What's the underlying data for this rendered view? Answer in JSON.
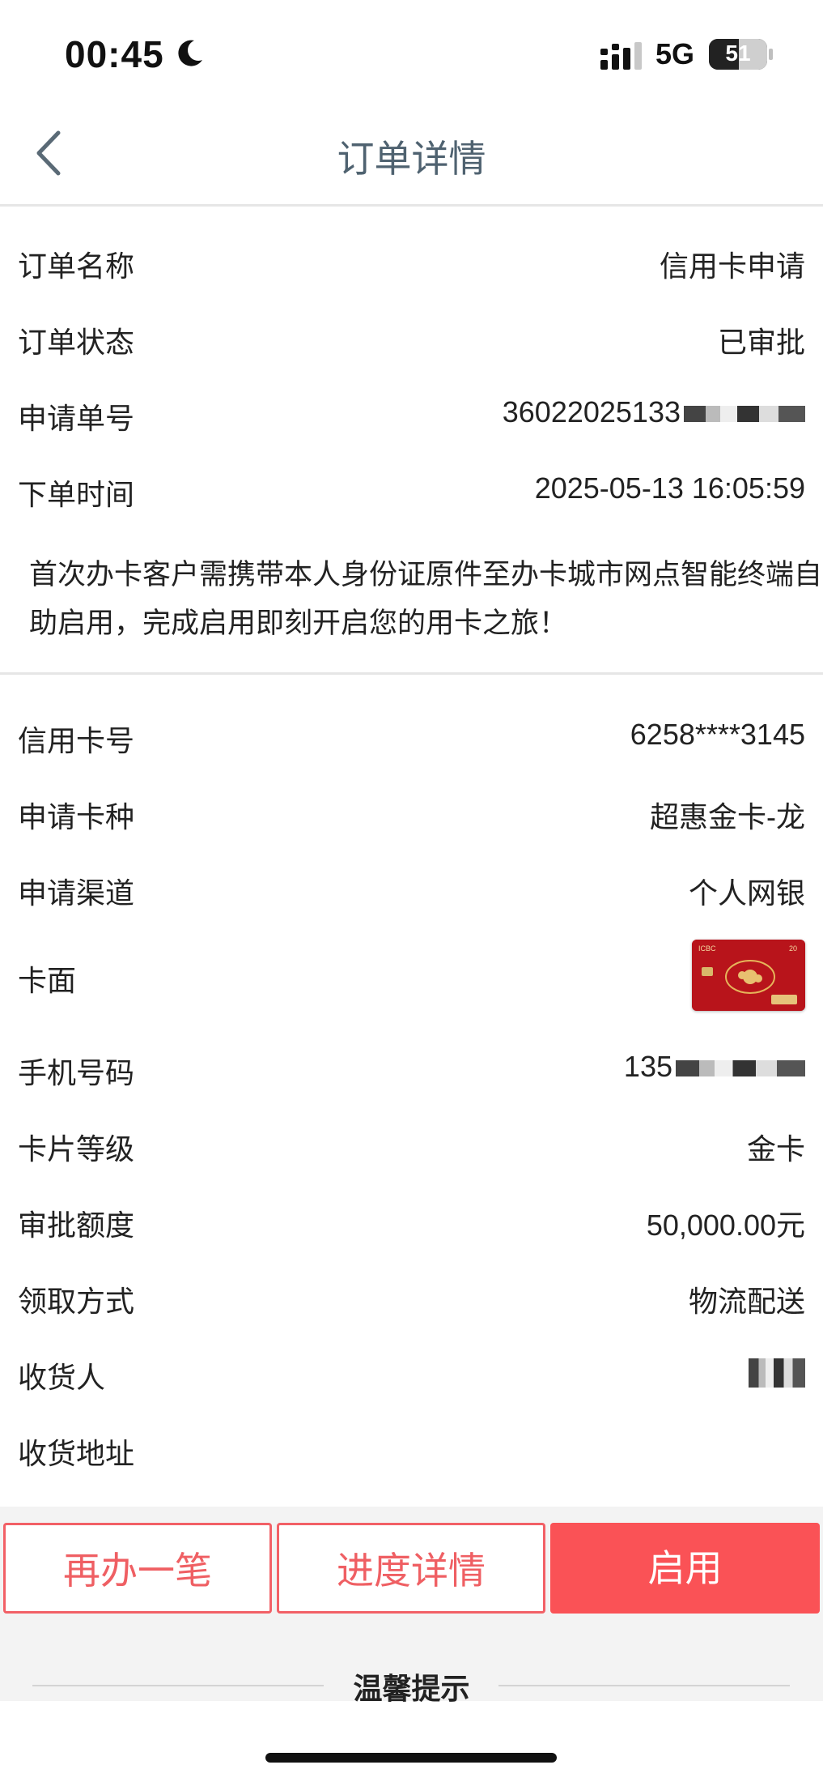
{
  "status_bar": {
    "time": "00:45",
    "network": "5G",
    "battery": "51",
    "battery_level": 0.51
  },
  "nav": {
    "title": "订单详情"
  },
  "order": [
    {
      "label": "订单名称",
      "value": "信用卡申请"
    },
    {
      "label": "订单状态",
      "value": "已审批"
    },
    {
      "label": "申请单号",
      "value": "36022025133"
    },
    {
      "label": "下单时间",
      "value": "2025-05-13 16:05:59"
    }
  ],
  "notice": "首次办卡客户需携带本人身份证原件至办卡城市网点智能终端自助启用，完成启用即刻开启您的用卡之旅！",
  "card": [
    {
      "label": "信用卡号",
      "value": "6258****3145"
    },
    {
      "label": "申请卡种",
      "value": "超惠金卡-龙"
    },
    {
      "label": "申请渠道",
      "value": "个人网银"
    },
    {
      "label": "卡面",
      "value": ""
    },
    {
      "label": "手机号码",
      "value": "135"
    },
    {
      "label": "卡片等级",
      "value": "金卡"
    },
    {
      "label": "审批额度",
      "value": "50,000.00元"
    },
    {
      "label": "领取方式",
      "value": "物流配送"
    },
    {
      "label": "收货人",
      "value": ""
    },
    {
      "label": "收货地址",
      "value": ""
    }
  ],
  "card_face": {
    "brand": "ICBC",
    "badge": "20"
  },
  "buttons": {
    "again": "再办一笔",
    "progress": "进度详情",
    "activate": "启用"
  },
  "tips": {
    "title": "温馨提示"
  },
  "colors": {
    "accent": "#fa5256",
    "outline": "#ef5f63",
    "nav_title": "#4f6270"
  }
}
